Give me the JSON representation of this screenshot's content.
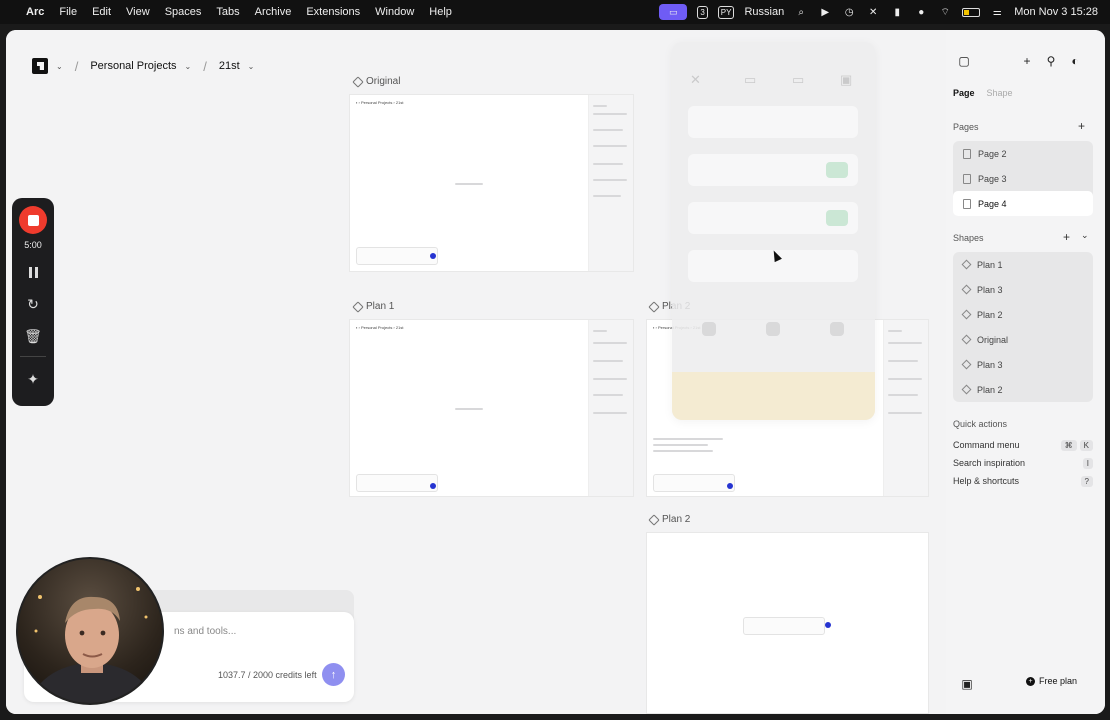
{
  "menubar": {
    "app": "Arc",
    "menus": [
      "File",
      "Edit",
      "View",
      "Spaces",
      "Tabs",
      "Archive",
      "Extensions",
      "Window",
      "Help"
    ],
    "input_source": "PY",
    "language": "Russian",
    "clock": "Mon Nov 3  15:28",
    "badge_count": "3"
  },
  "breadcrumb": {
    "project": "Personal Projects",
    "page": "21st"
  },
  "frames": {
    "original_label": "Original",
    "plan1_label": "Plan 1",
    "plan2_label": "Plan 2",
    "plan2b_label": "Plan 2"
  },
  "recorder": {
    "time": "5:00"
  },
  "chat": {
    "placeholder": "ns and tools...",
    "credits": "1037.7 / 2000 credits left"
  },
  "sidebar": {
    "tabs": [
      "Page",
      "Shape"
    ],
    "pages_title": "Pages",
    "pages": [
      "Page 2",
      "Page 3",
      "Page 4"
    ],
    "selected_page": "Page 4",
    "shapes_title": "Shapes",
    "shapes": [
      "Plan 1",
      "Plan 3",
      "Plan 2",
      "Original",
      "Plan 3",
      "Plan 2"
    ],
    "quick_actions_title": "Quick actions",
    "quick_actions": [
      {
        "label": "Command menu",
        "keys": [
          "⌘",
          "K"
        ]
      },
      {
        "label": "Search inspiration",
        "keys": [
          "I"
        ]
      },
      {
        "label": "Help & shortcuts",
        "keys": [
          "?"
        ]
      }
    ],
    "plan_button": "Free plan"
  },
  "icons": {
    "accent": "#6f5cf5",
    "record_color": "#ef3b2d",
    "send_color": "#8f8ff0"
  }
}
